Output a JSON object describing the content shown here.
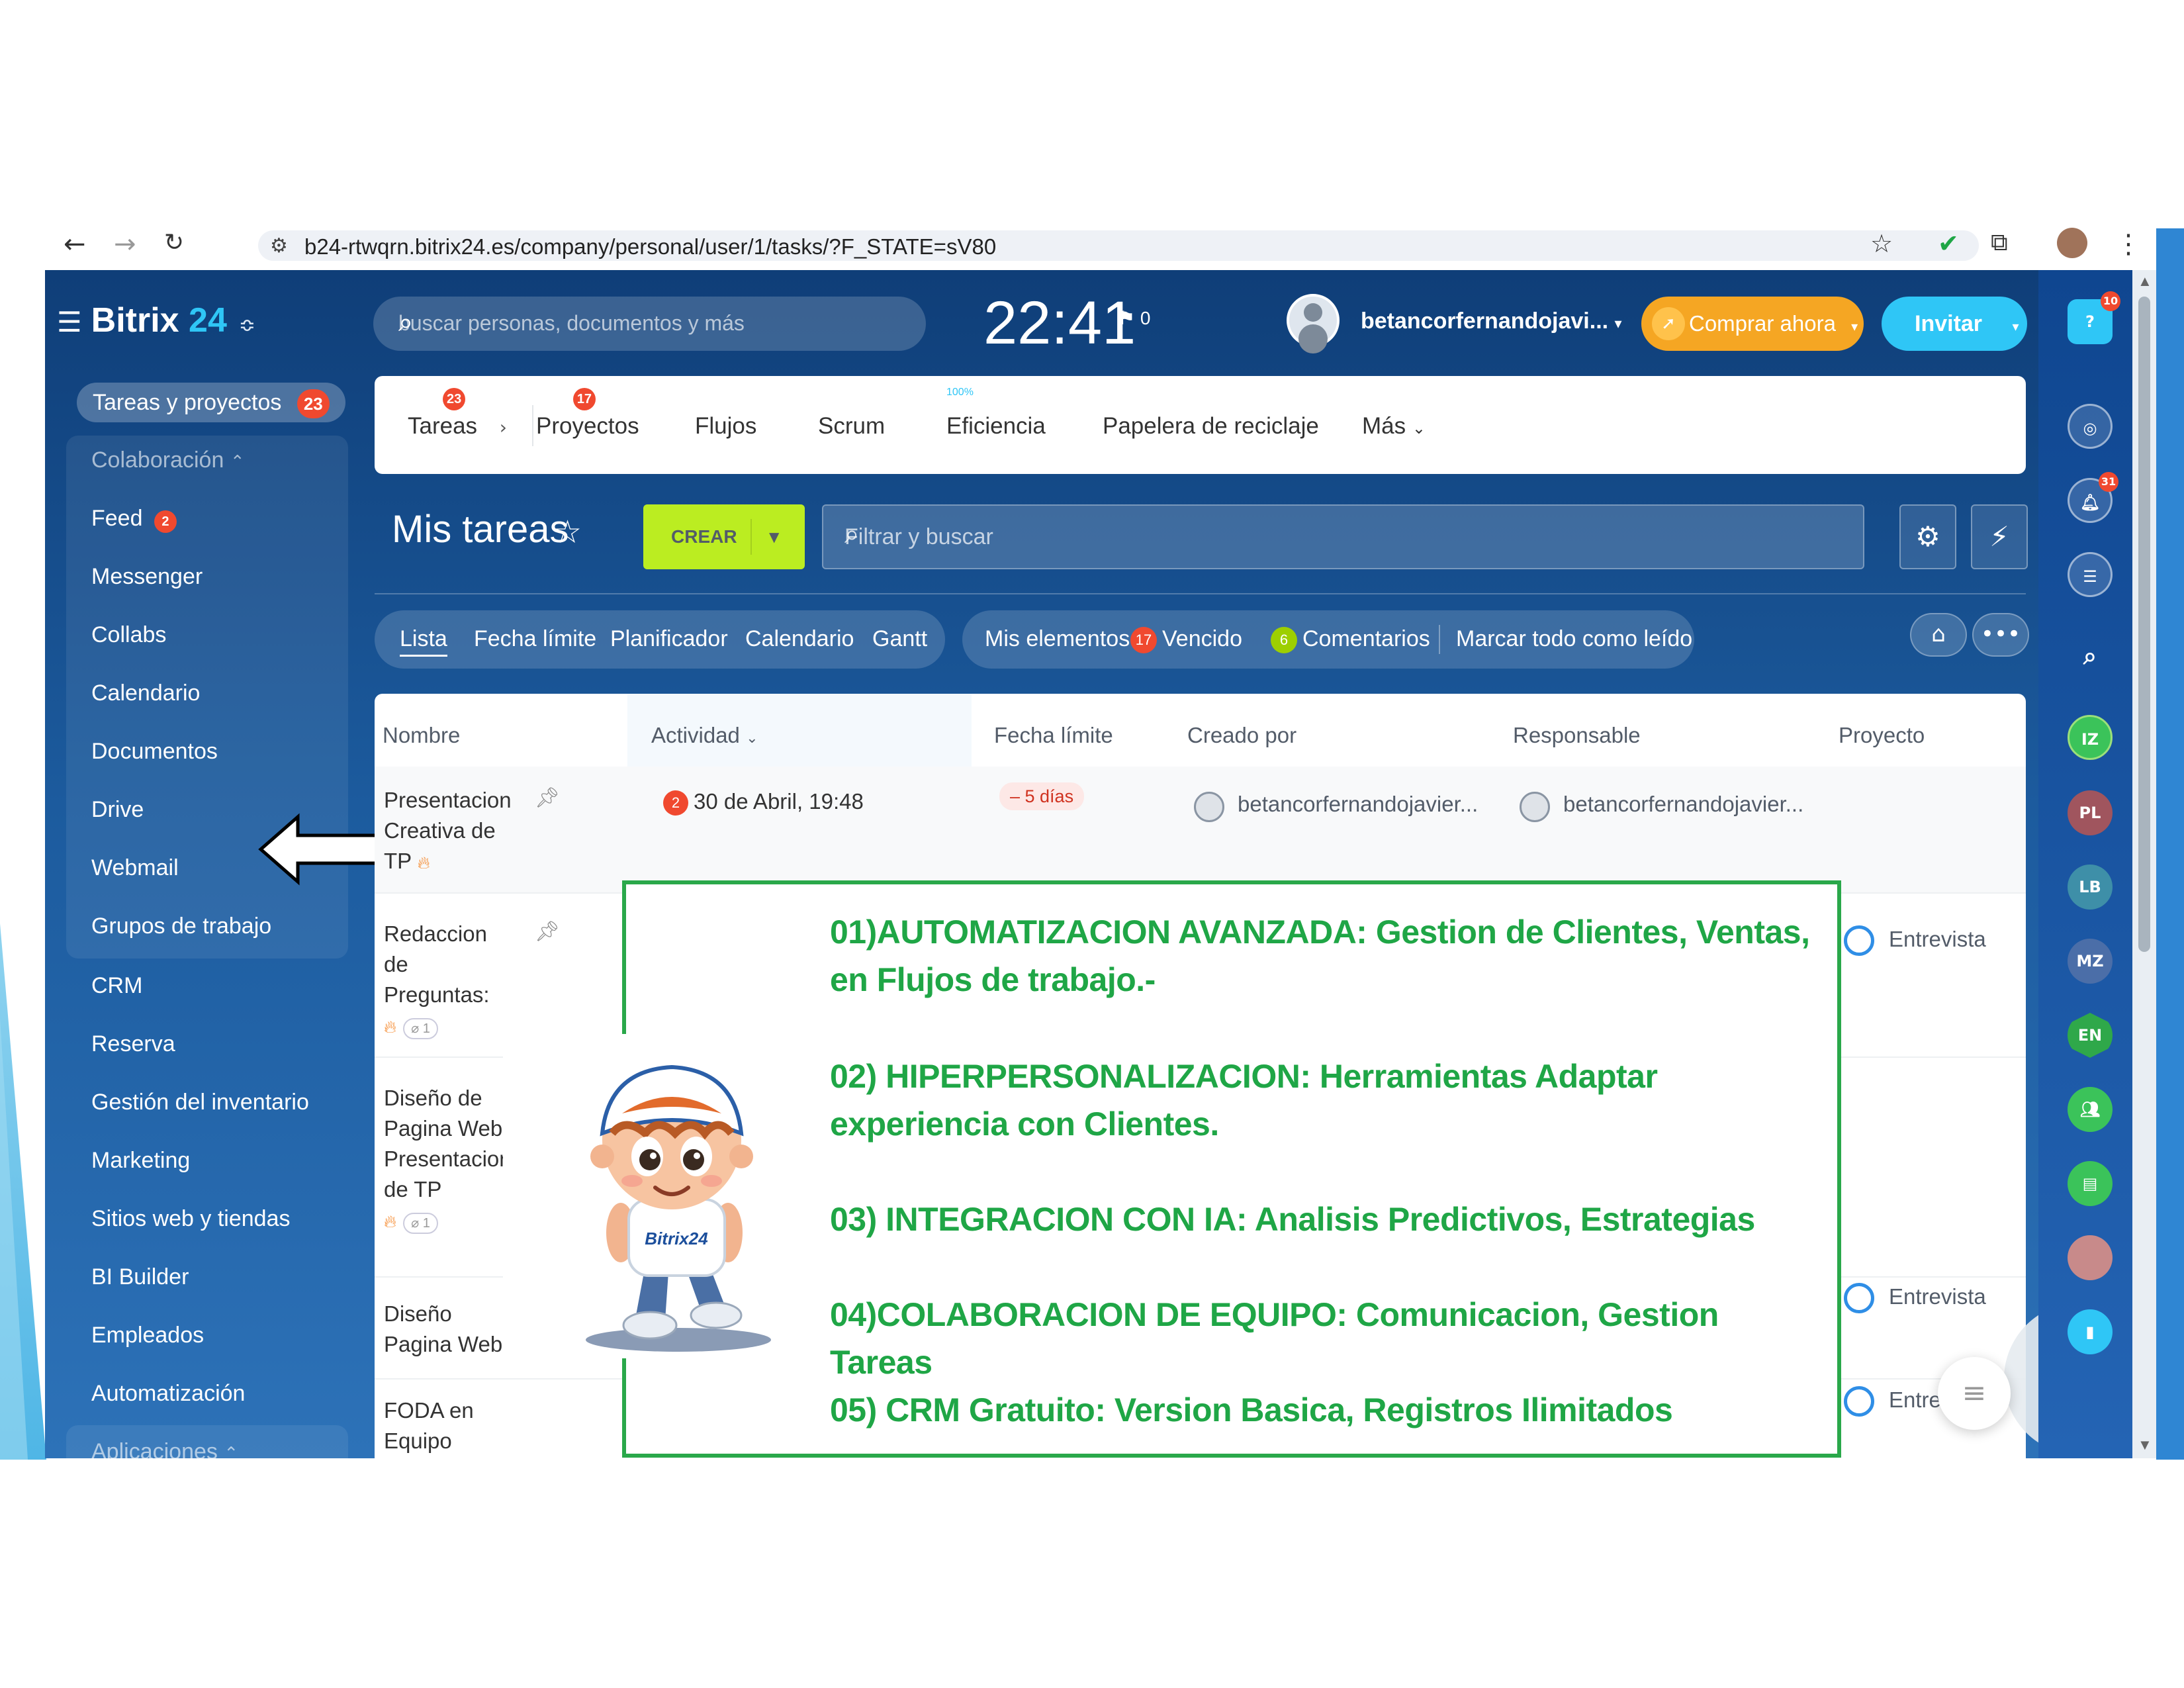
{
  "browser": {
    "url": "b24-rtwqrn.bitrix24.es/company/personal/user/1/tasks/?F_STATE=sV80"
  },
  "app": {
    "logo_text": "Bitrix",
    "logo_num": "24",
    "search_placeholder": "buscar personas, documentos y más",
    "clock": "22:41",
    "flag_count": "0",
    "username": "betancorfernandojavi...",
    "buy_label": "Comprar ahora",
    "invite_label": "Invitar"
  },
  "sidebar": {
    "top_item": "Tareas y proyectos",
    "top_badge": "23",
    "group_label": "Colaboración",
    "items": [
      {
        "label": "Feed",
        "badge": "2"
      },
      {
        "label": "Messenger"
      },
      {
        "label": "Collabs"
      },
      {
        "label": "Calendario"
      },
      {
        "label": "Documentos"
      },
      {
        "label": "Drive"
      },
      {
        "label": "Webmail"
      },
      {
        "label": "Grupos de trabajo"
      },
      {
        "label": "CRM"
      },
      {
        "label": "Reserva"
      },
      {
        "label": "Gestión del inventario"
      },
      {
        "label": "Marketing"
      },
      {
        "label": "Sitios web y tiendas"
      },
      {
        "label": "BI Builder"
      },
      {
        "label": "Empleados"
      },
      {
        "label": "Automatización"
      }
    ],
    "apps_label": "Aplicaciones"
  },
  "topnav": {
    "tabs": [
      {
        "label": "Tareas",
        "badge": "23"
      },
      {
        "label": "Proyectos",
        "badge": "17"
      },
      {
        "label": "Flujos"
      },
      {
        "label": "Scrum"
      },
      {
        "label": "Eficiencia",
        "sup": "100%"
      },
      {
        "label": "Papelera de reciclaje"
      },
      {
        "label": "Más"
      }
    ]
  },
  "toolbar": {
    "title": "Mis tareas",
    "create_label": "CREAR",
    "filter_placeholder": "Filtrar y buscar"
  },
  "views": {
    "tabs": [
      "Lista",
      "Fecha límite",
      "Planificador",
      "Calendario",
      "Gantt"
    ],
    "my_items_label": "Mis elementos:",
    "overdue_count": "17",
    "overdue_label": "Vencido",
    "comments_count": "6",
    "comments_label": "Comentarios",
    "mark_read_label": "Marcar todo como leído"
  },
  "grid": {
    "columns": [
      "Nombre",
      "Actividad",
      "Fecha límite",
      "Creado por",
      "Responsable",
      "Proyecto"
    ],
    "rows": [
      {
        "name_lines": [
          "Presentacion",
          "Creativa de",
          "TP"
        ],
        "activity_count": "2",
        "activity": "30 de Abril, 19:48",
        "deadline": "– 5 días",
        "creator": "betancorfernandojavier...",
        "responsible": "betancorfernandojavier...",
        "project": ""
      },
      {
        "name_lines": [
          "Redaccion",
          "de",
          "Preguntas:"
        ],
        "attach": "1",
        "project": "Entrevista"
      },
      {
        "name_lines": [
          "Diseño de",
          "Pagina Web",
          "Presentacion",
          "de TP"
        ],
        "attach": "1",
        "project": ""
      },
      {
        "name_lines": [
          "Diseño",
          "Pagina Web"
        ],
        "project": "Entrevista"
      },
      {
        "name_lines": [
          "FODA en",
          "Equipo"
        ],
        "project": "Entrev"
      }
    ]
  },
  "annotation": {
    "lines": [
      "01)AUTOMATIZACION AVANZADA: Gestion de Clientes, Ventas, en Flujos de trabajo.-",
      "02) HIPERPERSONALIZACION: Herramientas Adaptar experiencia con Clientes.",
      "03) INTEGRACION CON IA: Analisis Predictivos, Estrategias",
      "04)COLABORACION DE EQUIPO: Comunicacion, Gestion Tareas",
      "05) CRM Gratuito: Version Basica, Registros Ilimitados"
    ],
    "mascot_shirt": "Bitrix24"
  },
  "rightpanel": {
    "help_badge": "10",
    "bell_badge": "31",
    "avatars": [
      "IZ",
      "PL",
      "LB",
      "MZ",
      "EN"
    ]
  },
  "colors": {
    "brand_blue": "#2fc6f6",
    "create_green": "#bbed21",
    "annotation_green": "#1fa646",
    "badge_red": "#f0492f",
    "buy_orange": "#f5a623"
  }
}
